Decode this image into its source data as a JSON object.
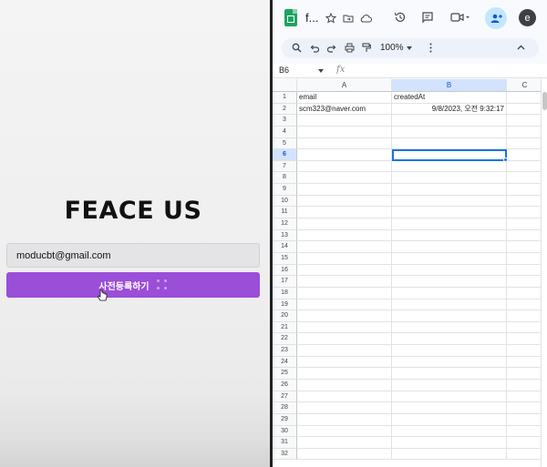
{
  "landing": {
    "title": "FEACE US",
    "email_value": "moducbt@gmail.com",
    "button_label": "사전등록하기"
  },
  "sheets": {
    "doc_title": "f...",
    "avatar_letter": "e",
    "zoom": "100%",
    "cell_ref": "B6",
    "fx": "fx",
    "columns": [
      "A",
      "B",
      "C"
    ],
    "rows": [
      [
        "email",
        "createdAt",
        ""
      ],
      [
        "scm323@naver.com",
        "9/8/2023, 오전 9:32:17",
        ""
      ]
    ],
    "row_numbers": [
      "1",
      "2",
      "3",
      "4",
      "5",
      "6",
      "7",
      "8",
      "9",
      "10",
      "11",
      "12",
      "13",
      "14",
      "15",
      "16",
      "17",
      "18",
      "19",
      "20",
      "21",
      "22",
      "23",
      "24",
      "25",
      "26",
      "27",
      "28",
      "29",
      "30",
      "31",
      "32"
    ],
    "selected_cell": "B6"
  },
  "colors": {
    "button_purple": "#9b4ed8",
    "sheets_green": "#1ea362",
    "selection_blue": "#1a73e8"
  }
}
